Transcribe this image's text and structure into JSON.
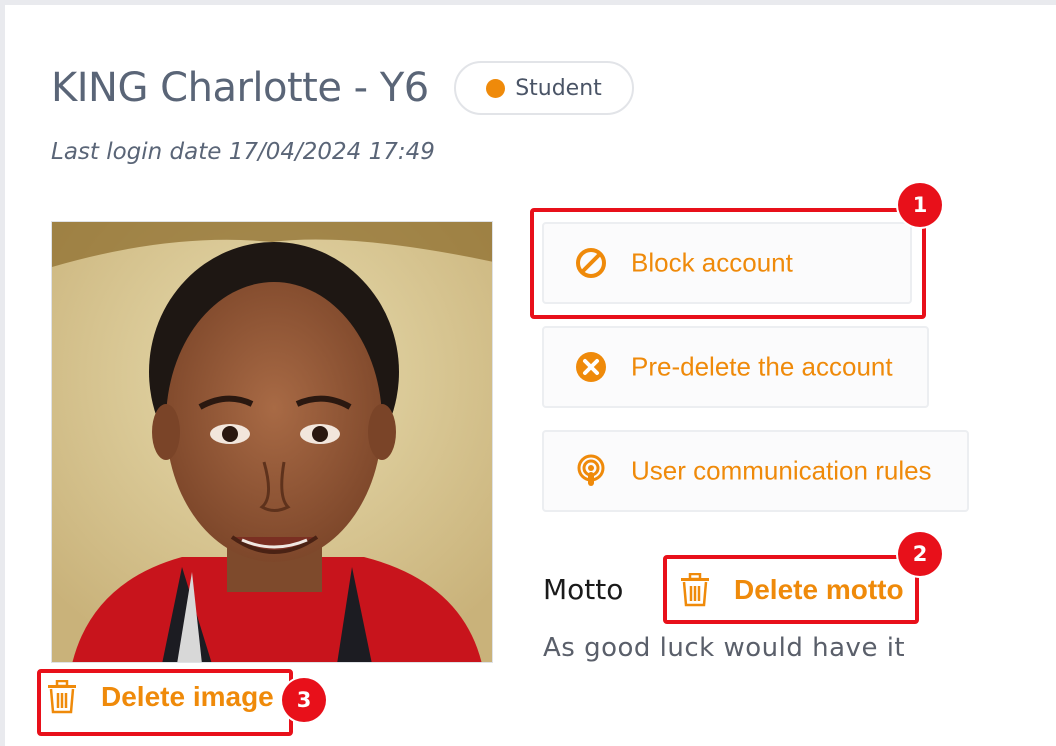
{
  "profile": {
    "name": "KING Charlotte - Y6",
    "role_badge": "Student",
    "role_color": "#ef8a0a",
    "last_login": "Last login date 17/04/2024 17:49"
  },
  "actions": {
    "block_label": "Block account",
    "predelete_label": "Pre-delete the account",
    "rules_label": "User communication rules"
  },
  "motto": {
    "heading": "Motto",
    "delete_label": "Delete motto",
    "text": "As good luck would have it"
  },
  "image": {
    "delete_label": "Delete image"
  },
  "callouts": [
    "1",
    "2",
    "3"
  ],
  "colors": {
    "accent": "#ef8a0a",
    "highlight": "#e8101a"
  }
}
